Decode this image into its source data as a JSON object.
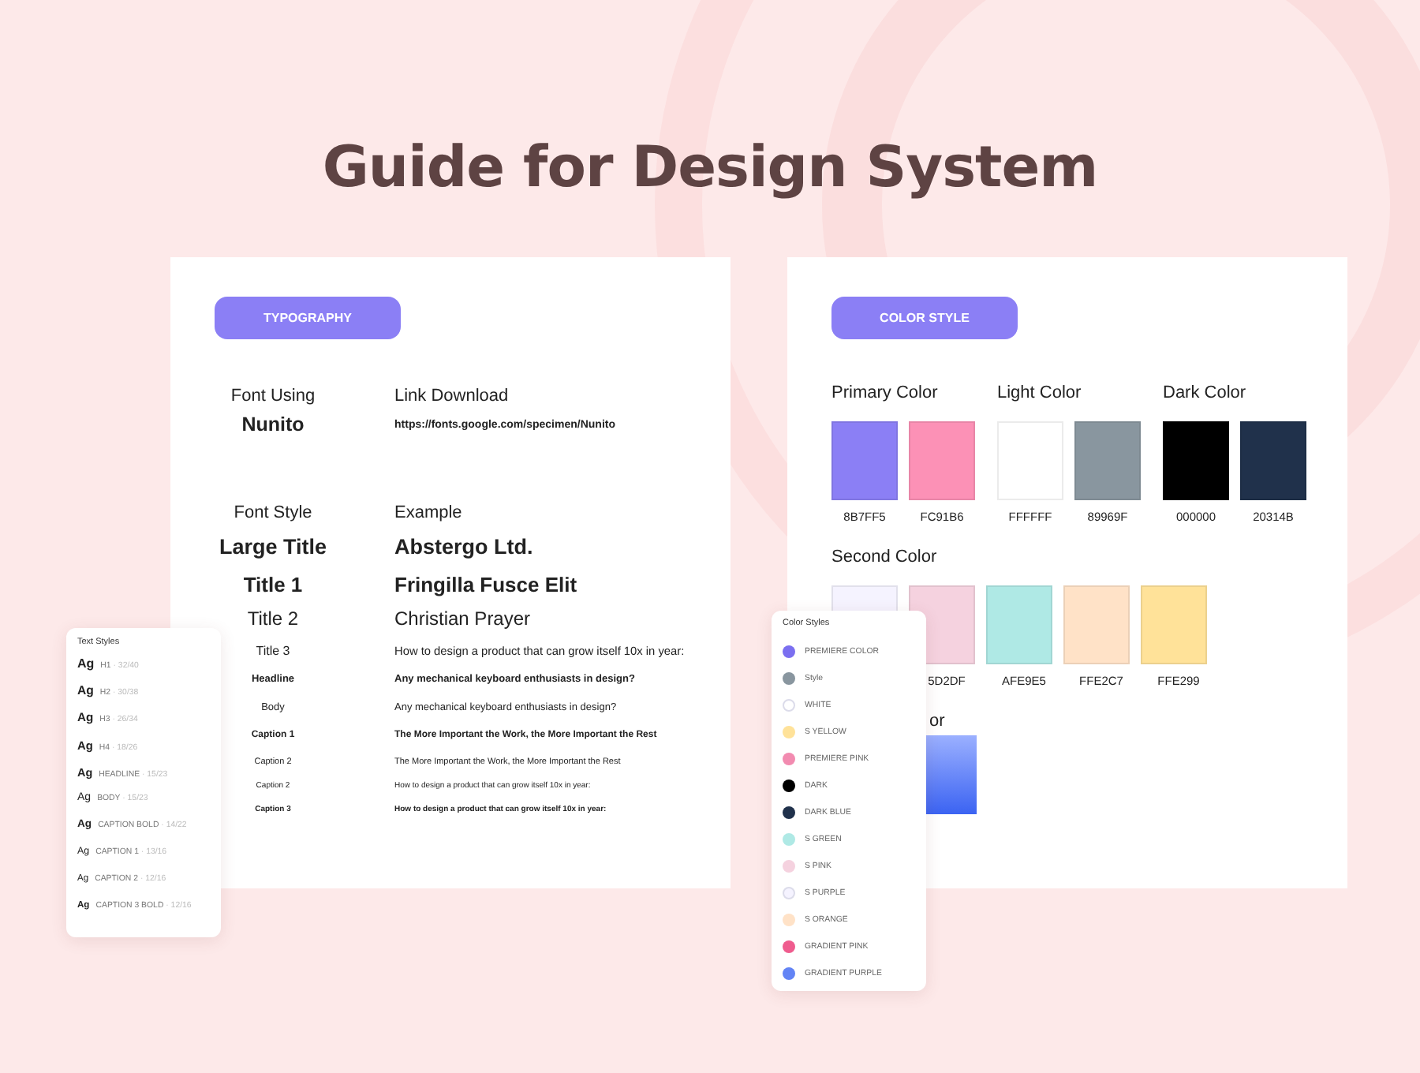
{
  "title": "Guide for Design System",
  "typography": {
    "badge": "TYPOGRAPHY",
    "font_using": {
      "label": "Font Using",
      "value": "Nunito"
    },
    "link_download": {
      "label": "Link Download",
      "value": "https://fonts.google.com/specimen/Nunito"
    },
    "font_style_header": "Font Style",
    "example_header": "Example",
    "rows": [
      {
        "kind": "largetitle",
        "style": "Large Title",
        "example": "Abstergo Ltd."
      },
      {
        "kind": "title1",
        "style": "Title 1",
        "example": "Fringilla Fusce Elit"
      },
      {
        "kind": "title2",
        "style": "Title 2",
        "example": "Christian Prayer"
      },
      {
        "kind": "title3",
        "style": "Title 3",
        "example": "How to design a product that can grow itself 10x in year:"
      },
      {
        "kind": "headline",
        "style": "Headline",
        "example": "Any mechanical keyboard enthusiasts in design?"
      },
      {
        "kind": "body",
        "style": "Body",
        "example": "Any mechanical keyboard enthusiasts in design?"
      },
      {
        "kind": "caption1",
        "style": "Caption 1",
        "example": "The More Important the Work, the More Important the Rest"
      },
      {
        "kind": "caption2",
        "style": "Caption 2",
        "example": "The More Important the Work, the More Important the Rest"
      },
      {
        "kind": "caption2small",
        "style": "Caption 2",
        "example": "How to design a product that can grow itself 10x in year:"
      },
      {
        "kind": "caption3",
        "style": "Caption 3",
        "example": "How to design a product that can grow itself 10x in year:"
      }
    ]
  },
  "color_style": {
    "badge": "COLOR STYLE",
    "groups": [
      {
        "title": "Primary Color",
        "swatches": [
          {
            "color": "#8b7ff5",
            "hex": "8B7FF5"
          },
          {
            "color": "#fc91b6",
            "hex": "FC91B6"
          }
        ]
      },
      {
        "title": "Light Color",
        "swatches": [
          {
            "color": "#ffffff",
            "hex": "FFFFFF"
          },
          {
            "color": "#89969f",
            "hex": "89969F"
          }
        ]
      },
      {
        "title": "Dark Color",
        "swatches": [
          {
            "color": "#000000",
            "hex": "000000"
          },
          {
            "color": "#20314b",
            "hex": "20314B"
          }
        ]
      }
    ],
    "second_color": {
      "swatches": [
        {
          "color": "#f5f3ff"
        },
        {
          "color": "#f5d2df",
          "hex": "5D2DF"
        },
        {
          "color": "#afe9e5",
          "hex": "AFE9E5"
        },
        {
          "color": "#ffe2c7",
          "hex": "FFE2C7"
        },
        {
          "color": "#ffe299",
          "hex": "FFE299"
        }
      ],
      "title": "Second Color"
    },
    "gradient": {
      "title": "or"
    }
  },
  "text_styles": {
    "title": "Text Styles",
    "items": [
      {
        "kind": "h1",
        "sample": "Ag",
        "name": "H1",
        "spec": "· 32/40"
      },
      {
        "kind": "h2",
        "sample": "Ag",
        "name": "H2",
        "spec": "· 30/38"
      },
      {
        "kind": "h3",
        "sample": "Ag",
        "name": "H3",
        "spec": "· 26/34"
      },
      {
        "kind": "h4",
        "sample": "Ag",
        "name": "H4",
        "spec": "· 18/26"
      },
      {
        "kind": "headline",
        "sample": "Ag",
        "name": "HEADLINE",
        "spec": "· 15/23"
      },
      {
        "kind": "body",
        "sample": "Ag",
        "name": "BODY",
        "spec": "· 15/23"
      },
      {
        "kind": "captionbold",
        "sample": "Ag",
        "name": "CAPTION BOLD",
        "spec": "· 14/22"
      },
      {
        "kind": "caption1",
        "sample": "Ag",
        "name": "CAPTION 1",
        "spec": "· 13/16"
      },
      {
        "kind": "caption2",
        "sample": "Ag",
        "name": "CAPTION 2",
        "spec": "· 12/16"
      },
      {
        "kind": "caption3bold",
        "sample": "Ag",
        "name": "CAPTION 3 BOLD",
        "spec": "· 12/16"
      }
    ]
  },
  "color_styles": {
    "title": "Color Styles",
    "items": [
      {
        "label": "PREMIERE COLOR",
        "color": "#7b6ff0"
      },
      {
        "label": "Style",
        "color": "#89969f"
      },
      {
        "label": "WHITE",
        "color": "#ffffff"
      },
      {
        "label": "S YELLOW",
        "color": "#ffe299"
      },
      {
        "label": "PREMIERE PINK",
        "color": "#f28bb0"
      },
      {
        "label": "DARK",
        "color": "#000000"
      },
      {
        "label": "DARK BLUE",
        "color": "#20314b"
      },
      {
        "label": "S GREEN",
        "color": "#afe9e5"
      },
      {
        "label": "S PINK",
        "color": "#f5d2df"
      },
      {
        "label": "S PURPLE",
        "color": "#f5f3ff"
      },
      {
        "label": "S ORANGE",
        "color": "#ffe2c7"
      },
      {
        "label": "GRADIENT PINK",
        "color": "#ef5c8e"
      },
      {
        "label": "GRADIENT PURPLE",
        "color": "#6384f5"
      }
    ]
  }
}
